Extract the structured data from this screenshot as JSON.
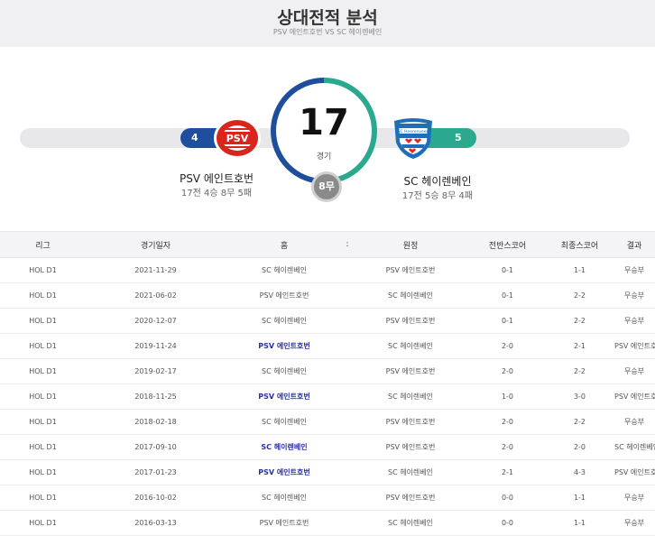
{
  "header": {
    "title": "상대전적 분석",
    "subtitle": "PSV 에인트호번 VS SC 헤이렌베인"
  },
  "summary": {
    "total": "17",
    "total_label": "경기",
    "draws": "8무",
    "home": {
      "name": "PSV 에인트호번",
      "record": "17전 4승 8무 5패",
      "wins": "4",
      "logo_text": "PSV",
      "color": "#1f4e9c"
    },
    "away": {
      "name": "SC 헤이렌베인",
      "record": "17전 5승 8무 4패",
      "wins": "5",
      "logo_text": "SC Heerenveen",
      "color": "#2aa98e"
    },
    "ring_fraction_home": 0.5,
    "ring_fraction_away": 0.5
  },
  "table": {
    "headers": [
      "리그",
      "경기일자",
      "홈",
      ":",
      "원정",
      "전반스코어",
      "최종스코어",
      "결과"
    ],
    "rows": [
      {
        "league": "HOL D1",
        "date": "2021-11-29",
        "home": "SC 헤이렌베인",
        "away": "PSV 에인트호번",
        "half": "0-1",
        "final": "1-1",
        "result": "무승부",
        "winner": ""
      },
      {
        "league": "HOL D1",
        "date": "2021-06-02",
        "home": "PSV 에인트호번",
        "away": "SC 헤이렌베인",
        "half": "0-1",
        "final": "2-2",
        "result": "무승부",
        "winner": ""
      },
      {
        "league": "HOL D1",
        "date": "2020-12-07",
        "home": "SC 헤이렌베인",
        "away": "PSV 에인트호번",
        "half": "0-1",
        "final": "2-2",
        "result": "무승부",
        "winner": ""
      },
      {
        "league": "HOL D1",
        "date": "2019-11-24",
        "home": "PSV 에인트호번",
        "away": "SC 헤이렌베인",
        "half": "2-0",
        "final": "2-1",
        "result": "PSV 에인트호번",
        "winner": "home"
      },
      {
        "league": "HOL D1",
        "date": "2019-02-17",
        "home": "SC 헤이렌베인",
        "away": "PSV 에인트호번",
        "half": "2-0",
        "final": "2-2",
        "result": "무승부",
        "winner": ""
      },
      {
        "league": "HOL D1",
        "date": "2018-11-25",
        "home": "PSV 에인트호번",
        "away": "SC 헤이렌베인",
        "half": "1-0",
        "final": "3-0",
        "result": "PSV 에인트호번",
        "winner": "home"
      },
      {
        "league": "HOL D1",
        "date": "2018-02-18",
        "home": "SC 헤이렌베인",
        "away": "PSV 에인트호번",
        "half": "2-0",
        "final": "2-2",
        "result": "무승부",
        "winner": ""
      },
      {
        "league": "HOL D1",
        "date": "2017-09-10",
        "home": "SC 헤이렌베인",
        "away": "PSV 에인트호번",
        "half": "2-0",
        "final": "2-0",
        "result": "SC 헤이렌베인",
        "winner": "home"
      },
      {
        "league": "HOL D1",
        "date": "2017-01-23",
        "home": "PSV 에인트호번",
        "away": "SC 헤이렌베인",
        "half": "2-1",
        "final": "4-3",
        "result": "PSV 에인트호번",
        "winner": "home"
      },
      {
        "league": "HOL D1",
        "date": "2016-10-02",
        "home": "SC 헤이렌베인",
        "away": "PSV 에인트호번",
        "half": "0-0",
        "final": "1-1",
        "result": "무승부",
        "winner": ""
      },
      {
        "league": "HOL D1",
        "date": "2016-03-13",
        "home": "PSV 에인트호번",
        "away": "SC 헤이렌베인",
        "half": "0-0",
        "final": "1-1",
        "result": "무승부",
        "winner": ""
      }
    ]
  }
}
